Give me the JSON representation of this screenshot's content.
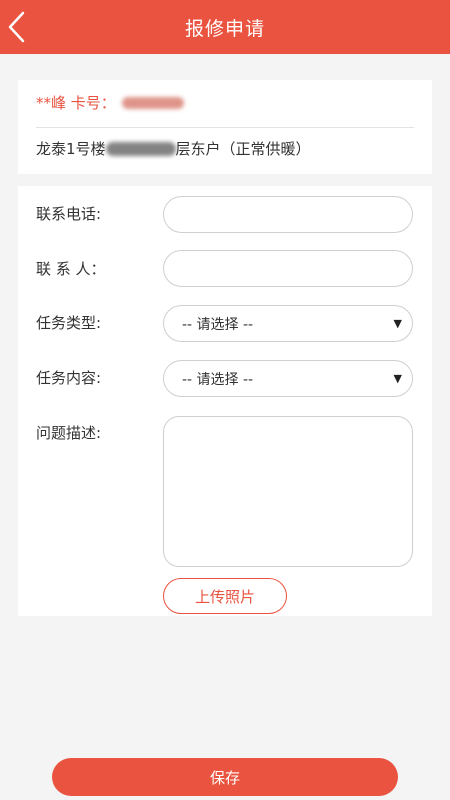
{
  "header": {
    "title": "报修申请",
    "back_icon": "chevron-left-icon"
  },
  "account": {
    "card_label": "**峰 卡号：",
    "address_prefix": "龙泰1号楼",
    "address_suffix": "层东户（正常供暖）"
  },
  "form": {
    "phone_label": "联系电话:",
    "contact_label": "联 系 人：",
    "task_type_label": "任务类型:",
    "task_type_value": "-- 请选择 --",
    "task_content_label": "任务内容:",
    "task_content_value": "-- 请选择 --",
    "description_label": "问题描述:",
    "upload_label": "上传照片"
  },
  "footer": {
    "save_label": "保存"
  },
  "colors": {
    "accent": "#e9533f",
    "background": "#f4f4f4"
  }
}
